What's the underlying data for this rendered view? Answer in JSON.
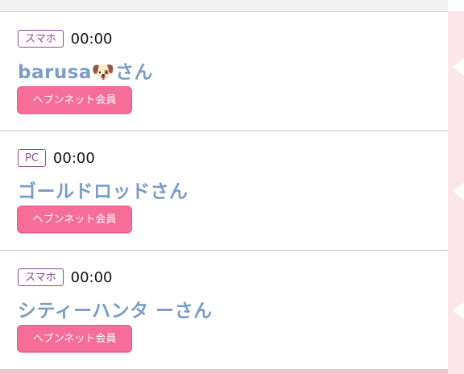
{
  "entries": [
    {
      "device": "スマホ",
      "time": "00:00",
      "name": "barusa🐶さん",
      "badge": "ヘブンネット会員"
    },
    {
      "device": "PC",
      "time": "00:00",
      "name": "ゴールドロッドさん",
      "badge": "ヘブンネット会員"
    },
    {
      "device": "スマホ",
      "time": "00:00",
      "name": "シティーハンタ ーさん",
      "badge": "ヘブンネット会員"
    }
  ],
  "colors": {
    "device_tag": "#8c4a9a",
    "name": "#7b9cc7",
    "badge_bg": "#f66d9a",
    "side_strip": "#fde6ea"
  }
}
